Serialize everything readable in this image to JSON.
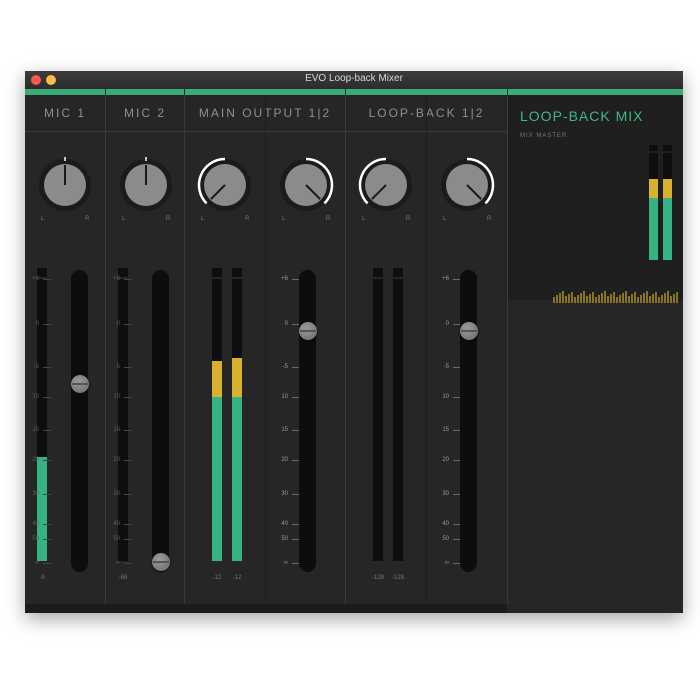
{
  "window": {
    "title": "EVO Loop-back Mixer",
    "accent": "#3aaa78",
    "meter_green": "#35b383",
    "meter_yellow": "#d9b12f"
  },
  "sections": [
    {
      "id": "mic1",
      "label": "MIC 1"
    },
    {
      "id": "mic2",
      "label": "MIC 2"
    },
    {
      "id": "main",
      "label": "MAIN OUTPUT 1|2"
    },
    {
      "id": "loop",
      "label": "LOOP-BACK 1|2"
    }
  ],
  "pan_labels": {
    "left": "L",
    "right": "R"
  },
  "fader_scale": [
    "+6",
    "0",
    "-5",
    "10",
    "15",
    "20",
    "30",
    "40",
    "50",
    "∞"
  ],
  "strips": [
    {
      "id": "mic1",
      "pan": 0.5,
      "meter_level": 0.37,
      "meter_peak": 0.37,
      "fader": 0.63,
      "readout": "-9"
    },
    {
      "id": "mic2",
      "pan": 0.5,
      "meter_level": 0,
      "meter_peak": 0,
      "fader": 0.0,
      "readout": "-68"
    },
    {
      "id": "main-l",
      "pan": 0.0,
      "meter_level": 0.58,
      "meter_peak": 0.71,
      "fader": 0.82,
      "readout": "-12"
    },
    {
      "id": "main-r",
      "pan": 1.0,
      "meter_level": 0.58,
      "meter_peak": 0.72,
      "fader": 0.82,
      "readout": "-12"
    },
    {
      "id": "loop-l",
      "pan": 0.0,
      "meter_level": 0,
      "meter_peak": 0,
      "fader": 0.82,
      "readout": "-128"
    },
    {
      "id": "loop-r",
      "pan": 1.0,
      "meter_level": 0,
      "meter_peak": 0,
      "fader": 0.82,
      "readout": "-128"
    }
  ],
  "loopback_mix": {
    "title": "LOOP-BACK MIX",
    "subtitle": "MIX MASTER",
    "meter_level_l": 0.58,
    "meter_peak_l": 0.76,
    "meter_level_r": 0.58,
    "meter_peak_r": 0.76
  }
}
